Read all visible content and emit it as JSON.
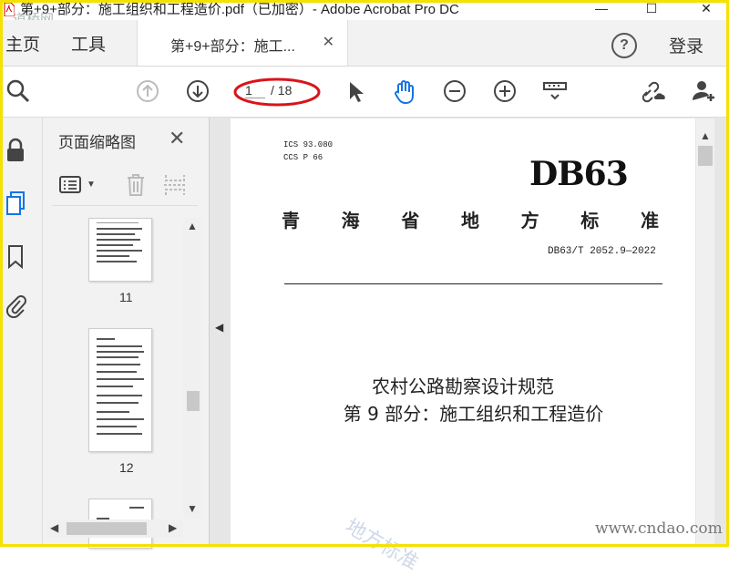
{
  "window": {
    "title": "第+9+部分：施工组织和工程造价.pdf（已加密）- Adobe Acrobat Pro DC",
    "watermark_top": "道桥网",
    "minimize": "—",
    "maximize": "☐",
    "close": "✕"
  },
  "tabs": {
    "home": "主页",
    "tools": "工具",
    "document": "第+9+部分：施工...",
    "close": "✕",
    "help": "?",
    "login": "登录"
  },
  "toolbar": {
    "current_page": "1",
    "total_pages": "/ 18"
  },
  "thumbnails": {
    "title": "页面缩略图",
    "close": "✕",
    "pages": [
      {
        "label": "11"
      },
      {
        "label": "12"
      }
    ]
  },
  "document": {
    "ics": "ICS  93.080",
    "ccs": "CCS P 66",
    "logo": "DB63",
    "province": [
      "青",
      "海",
      "省",
      "地",
      "方",
      "标",
      "准"
    ],
    "standard_no": "DB63/T 2052.9—2022",
    "title_line1": "农村公路勘察设计规范",
    "title_line2": "第 9 部分：施工组织和工程造价"
  },
  "watermarks": {
    "diagonal": "地方标准",
    "site": "www.cndao.com"
  },
  "colors": {
    "frame": "#f5e100",
    "oval": "#d9141a",
    "hand_tool": "#1473e6"
  }
}
